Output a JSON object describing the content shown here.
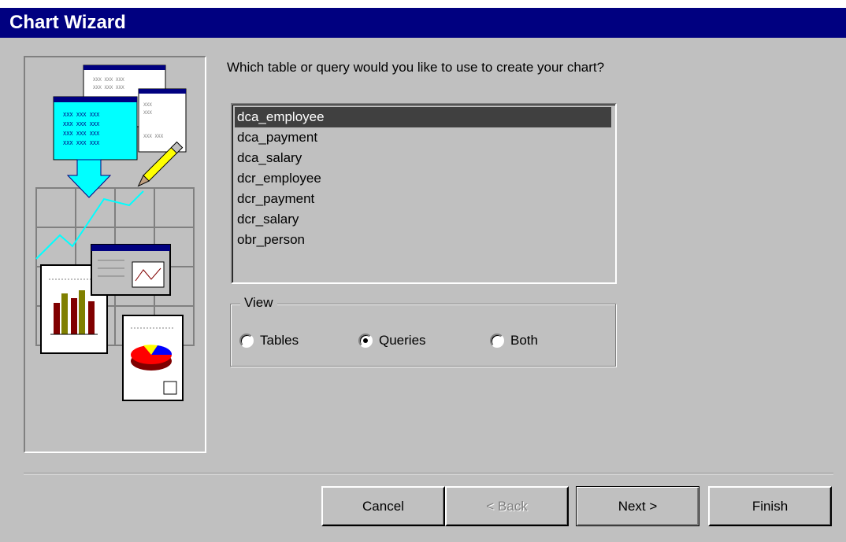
{
  "window": {
    "title": "Chart Wizard"
  },
  "prompt": "Which table or query would you like to use to create your chart?",
  "list": {
    "items": [
      "dca_employee",
      "dca_payment",
      "dca_salary",
      "dcr_employee",
      "dcr_payment",
      "dcr_salary",
      "obr_person"
    ],
    "selected": "dca_employee"
  },
  "view": {
    "label": "View",
    "options": [
      {
        "label": "Tables",
        "checked": false
      },
      {
        "label": "Queries",
        "checked": true
      },
      {
        "label": "Both",
        "checked": false
      }
    ]
  },
  "buttons": {
    "cancel": "Cancel",
    "back": "< Back",
    "next": "Next >",
    "finish": "Finish"
  },
  "colors": {
    "titlebar": "#000080",
    "face": "#c0c0c0",
    "selection": "#404040",
    "accent": "#00ffff"
  },
  "illustration": {
    "icons": [
      "table-stack-icon",
      "down-arrow-icon",
      "pencil-icon",
      "line-graph-icon",
      "bar-chart-doc-icon",
      "pie-chart-doc-icon",
      "dialog-thumbnail-icon"
    ]
  }
}
